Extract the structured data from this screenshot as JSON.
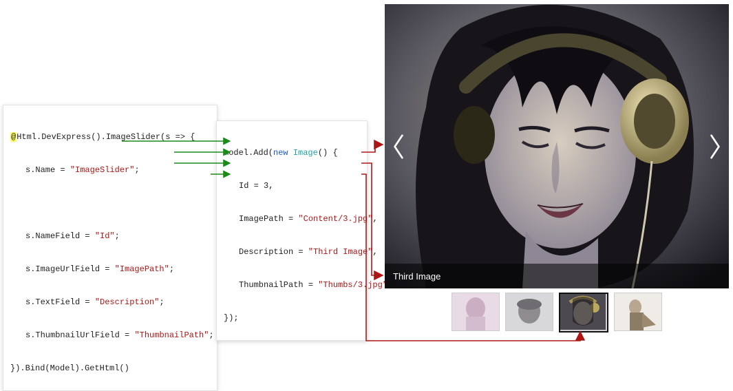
{
  "code1": {
    "line1_at": "@",
    "line1_rest": "Html.DevExpress().ImageSlider(s => {",
    "line2_a": "s.Name = ",
    "line2_b": "\"ImageSlider\"",
    "line2_c": ";",
    "line4_a": "s.NameField = ",
    "line4_b": "\"Id\"",
    "line4_c": ";",
    "line5_a": "s.ImageUrlField = ",
    "line5_b": "\"ImagePath\"",
    "line5_c": ";",
    "line6_a": "s.TextField = ",
    "line6_b": "\"Description\"",
    "line6_c": ";",
    "line7_a": "s.ThumbnailUrlField = ",
    "line7_b": "\"ThumbnailPath\"",
    "line7_c": ";",
    "line8": "}).Bind(Model).GetHtml()"
  },
  "code2": {
    "line1_a": "model.Add(",
    "line1_b": "new",
    "line1_c": " ",
    "line1_d": "Image",
    "line1_e": "() {",
    "line2": "Id = 3,",
    "line3_a": "ImagePath = ",
    "line3_b": "\"Content/3.jpg\"",
    "line3_c": ",",
    "line4_a": "Description = ",
    "line4_b": "\"Third Image\"",
    "line4_c": ",",
    "line5_a": "ThumbnailPath = ",
    "line5_b": "\"Thumbs/3.jpg\"",
    "line6": "});"
  },
  "slider": {
    "caption": "Third Image"
  }
}
